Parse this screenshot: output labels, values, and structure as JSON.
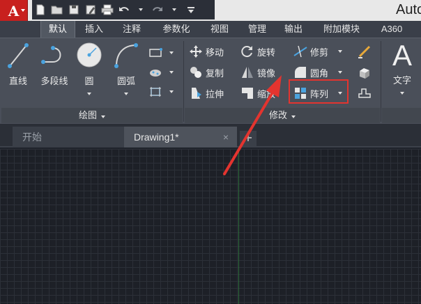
{
  "titlebar": {
    "app_title": "Auto",
    "app_logo": "A",
    "quick_access": [
      "new-icon",
      "open-icon",
      "save-icon",
      "saveas-icon",
      "print-icon",
      "undo-icon",
      "redo-icon",
      "qat-menu-icon"
    ]
  },
  "ribbon_tabs": [
    {
      "label": "默认",
      "active": true
    },
    {
      "label": "插入"
    },
    {
      "label": "注释"
    },
    {
      "label": "参数化"
    },
    {
      "label": "视图"
    },
    {
      "label": "管理"
    },
    {
      "label": "输出"
    },
    {
      "label": "附加模块"
    },
    {
      "label": "A360"
    }
  ],
  "draw_panel": {
    "title": "绘图",
    "tools": {
      "line": "直线",
      "polyline": "多段线",
      "circle": "圆",
      "arc": "圆弧"
    }
  },
  "modify_panel": {
    "title": "修改",
    "tools": {
      "move": "移动",
      "rotate": "旋转",
      "trim": "修剪",
      "copy": "复制",
      "mirror": "镜像",
      "fillet": "圆角",
      "stretch": "拉伸",
      "scale": "缩放",
      "array": "阵列"
    }
  },
  "annotation_panel": {
    "text": "文字",
    "text_glyph": "A"
  },
  "file_tabs": {
    "start": "开始",
    "drawing": "Drawing1*",
    "close": "×"
  },
  "colors": {
    "highlight": "#e3342f",
    "arrow": "#e3342f",
    "app_button": "#c8201e"
  }
}
